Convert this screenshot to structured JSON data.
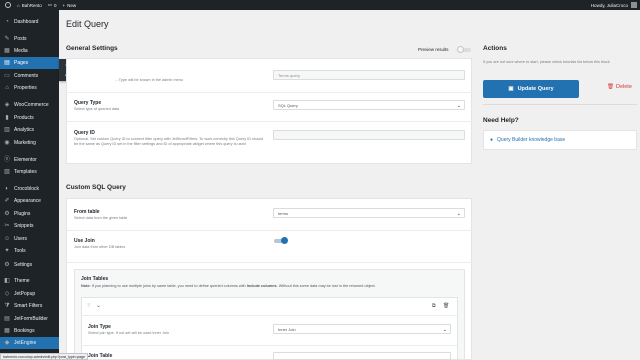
{
  "adminbar": {
    "site_name": "BahRento",
    "comments_count": "0",
    "new_label": "New",
    "howdy": "Howdy, JuliaCroco"
  },
  "sidebar": {
    "items": [
      {
        "label": "Dashboard",
        "icon": "dashboard-icon"
      },
      {
        "label": "Posts",
        "icon": "pin-icon"
      },
      {
        "label": "Media",
        "icon": "media-icon"
      },
      {
        "label": "Pages",
        "icon": "pages-icon"
      },
      {
        "label": "Comments",
        "icon": "comments-icon"
      },
      {
        "label": "Properties",
        "icon": "properties-icon"
      },
      {
        "label": "WooCommerce",
        "icon": "woocommerce-icon"
      },
      {
        "label": "Products",
        "icon": "products-icon"
      },
      {
        "label": "Analytics",
        "icon": "analytics-icon"
      },
      {
        "label": "Marketing",
        "icon": "marketing-icon"
      },
      {
        "label": "Elementor",
        "icon": "elementor-icon"
      },
      {
        "label": "Templates",
        "icon": "templates-icon"
      },
      {
        "label": "Crocoblock",
        "icon": "crocoblock-icon"
      },
      {
        "label": "Appearance",
        "icon": "appearance-icon"
      },
      {
        "label": "Plugins",
        "icon": "plugins-icon"
      },
      {
        "label": "Snippets",
        "icon": "snippets-icon"
      },
      {
        "label": "Users",
        "icon": "users-icon"
      },
      {
        "label": "Tools",
        "icon": "tools-icon"
      },
      {
        "label": "Settings",
        "icon": "settings-icon"
      },
      {
        "label": "Theme",
        "icon": "theme-icon"
      },
      {
        "label": "JetPopup",
        "icon": "jetpopup-icon"
      },
      {
        "label": "Smart Filters",
        "icon": "filters-icon"
      },
      {
        "label": "JetFormBuilder",
        "icon": "formbuilder-icon"
      },
      {
        "label": "Bookings",
        "icon": "bookings-icon"
      },
      {
        "label": "JetEngine",
        "icon": "jetengine-icon"
      }
    ],
    "flyout": [
      "All Pages",
      "Add New"
    ]
  },
  "page_title": "Edit Query",
  "general": {
    "title": "General Settings",
    "preview_label": "Preview results",
    "preview_on": false,
    "name_desc": "…Type will be shown in the admin menu",
    "name_value": "Terms query",
    "query_type_label": "Query Type",
    "query_type_desc": "Select type of queried data",
    "query_type_value": "SQL Query",
    "query_id_label": "Query ID",
    "query_id_desc": "Optional. Set custom Query ID to connect filter query with JetSmartFilters. To work correctly this Query ID should be the same as Query ID set in the filter settings and ID of appropriate widget where this query is used"
  },
  "sql": {
    "title": "Custom SQL Query",
    "from_label": "From table",
    "from_desc": "Select data from the given table",
    "from_value": "terms",
    "use_join_label": "Use Join",
    "use_join_desc": "Join data from other DB tables",
    "use_join_on": true,
    "join_tables_title": "Join Tables",
    "note_prefix": "Note:",
    "note_text": "If you planning to use multiple joins by same table, you need to define queried columns with",
    "note_bold": "Include columns",
    "note_suffix": ". Without this some data may be lost in the returned object.",
    "join_type_label": "Join Type",
    "join_type_desc": "Select join type. If not set will be used Inner Join",
    "join_type_value": "Inner Join",
    "join_table_label": "Join Table"
  },
  "actions": {
    "title": "Actions",
    "desc": "If you are not sure where to start, please check tutorials list below this block",
    "update_label": "Update Query",
    "delete_label": "Delete"
  },
  "help": {
    "title": "Need Help?",
    "link": "Query Builder knowledge base"
  },
  "status_url": "bahrento.croco/wp-admin/edit.php?post_type=page",
  "colors": {
    "accent": "#2271b1",
    "adminbar": "#1d2327",
    "delete": "#d63638"
  }
}
